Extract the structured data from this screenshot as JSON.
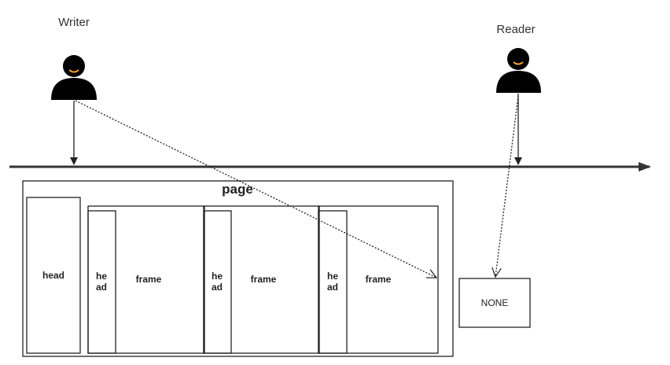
{
  "actors": {
    "writer": {
      "label": "Writer",
      "icon": "person-icon"
    },
    "reader": {
      "label": "Reader",
      "icon": "person-icon"
    }
  },
  "page": {
    "title": "page",
    "head_label": "head",
    "frames": [
      {
        "head_line1": "he",
        "head_line2": "ad",
        "label": "frame"
      },
      {
        "head_line1": "he",
        "head_line2": "ad",
        "label": "frame"
      },
      {
        "head_line1": "he",
        "head_line2": "ad",
        "label": "frame"
      }
    ]
  },
  "none_box": {
    "label": "NONE"
  },
  "colors": {
    "stroke": "#222222",
    "icon_fill": "#000000",
    "smile": "#f5a623"
  }
}
